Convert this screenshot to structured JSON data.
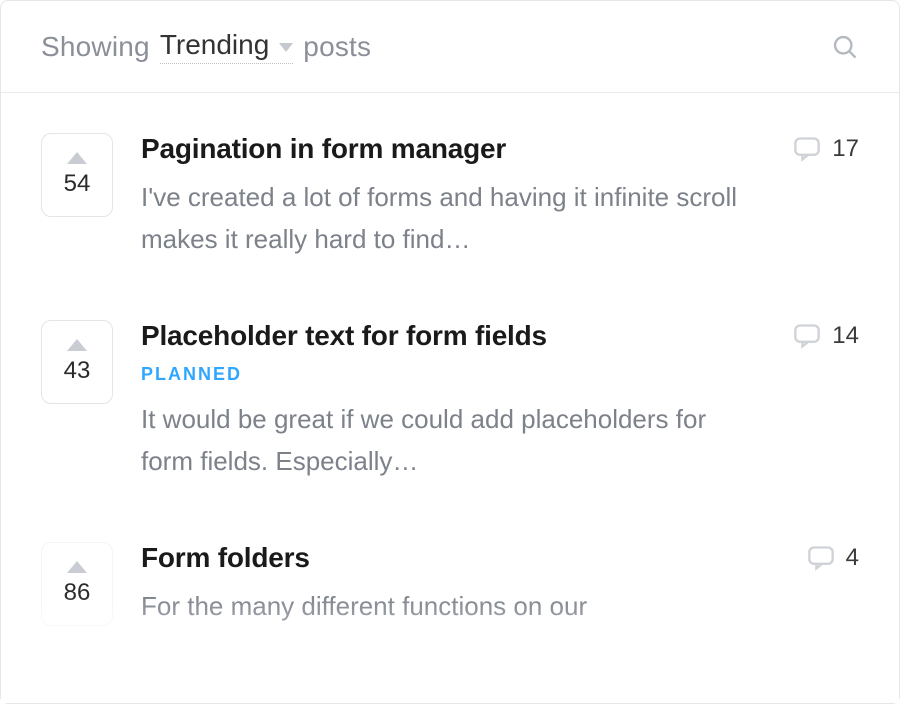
{
  "header": {
    "showing_label": "Showing",
    "sort_value": "Trending",
    "posts_label": "posts"
  },
  "posts": [
    {
      "votes": 54,
      "title": "Pagination in form manager",
      "status": null,
      "excerpt": "I've created a lot of forms and having it infinite scroll makes it really hard to find…",
      "comments": 17
    },
    {
      "votes": 43,
      "title": "Placeholder text for form fields",
      "status": "PLANNED",
      "excerpt": "It would be great if we could add placeholders for form fields. Especially…",
      "comments": 14
    },
    {
      "votes": 86,
      "title": "Form folders",
      "status": null,
      "excerpt": "For the many different functions on our",
      "comments": 4
    }
  ]
}
